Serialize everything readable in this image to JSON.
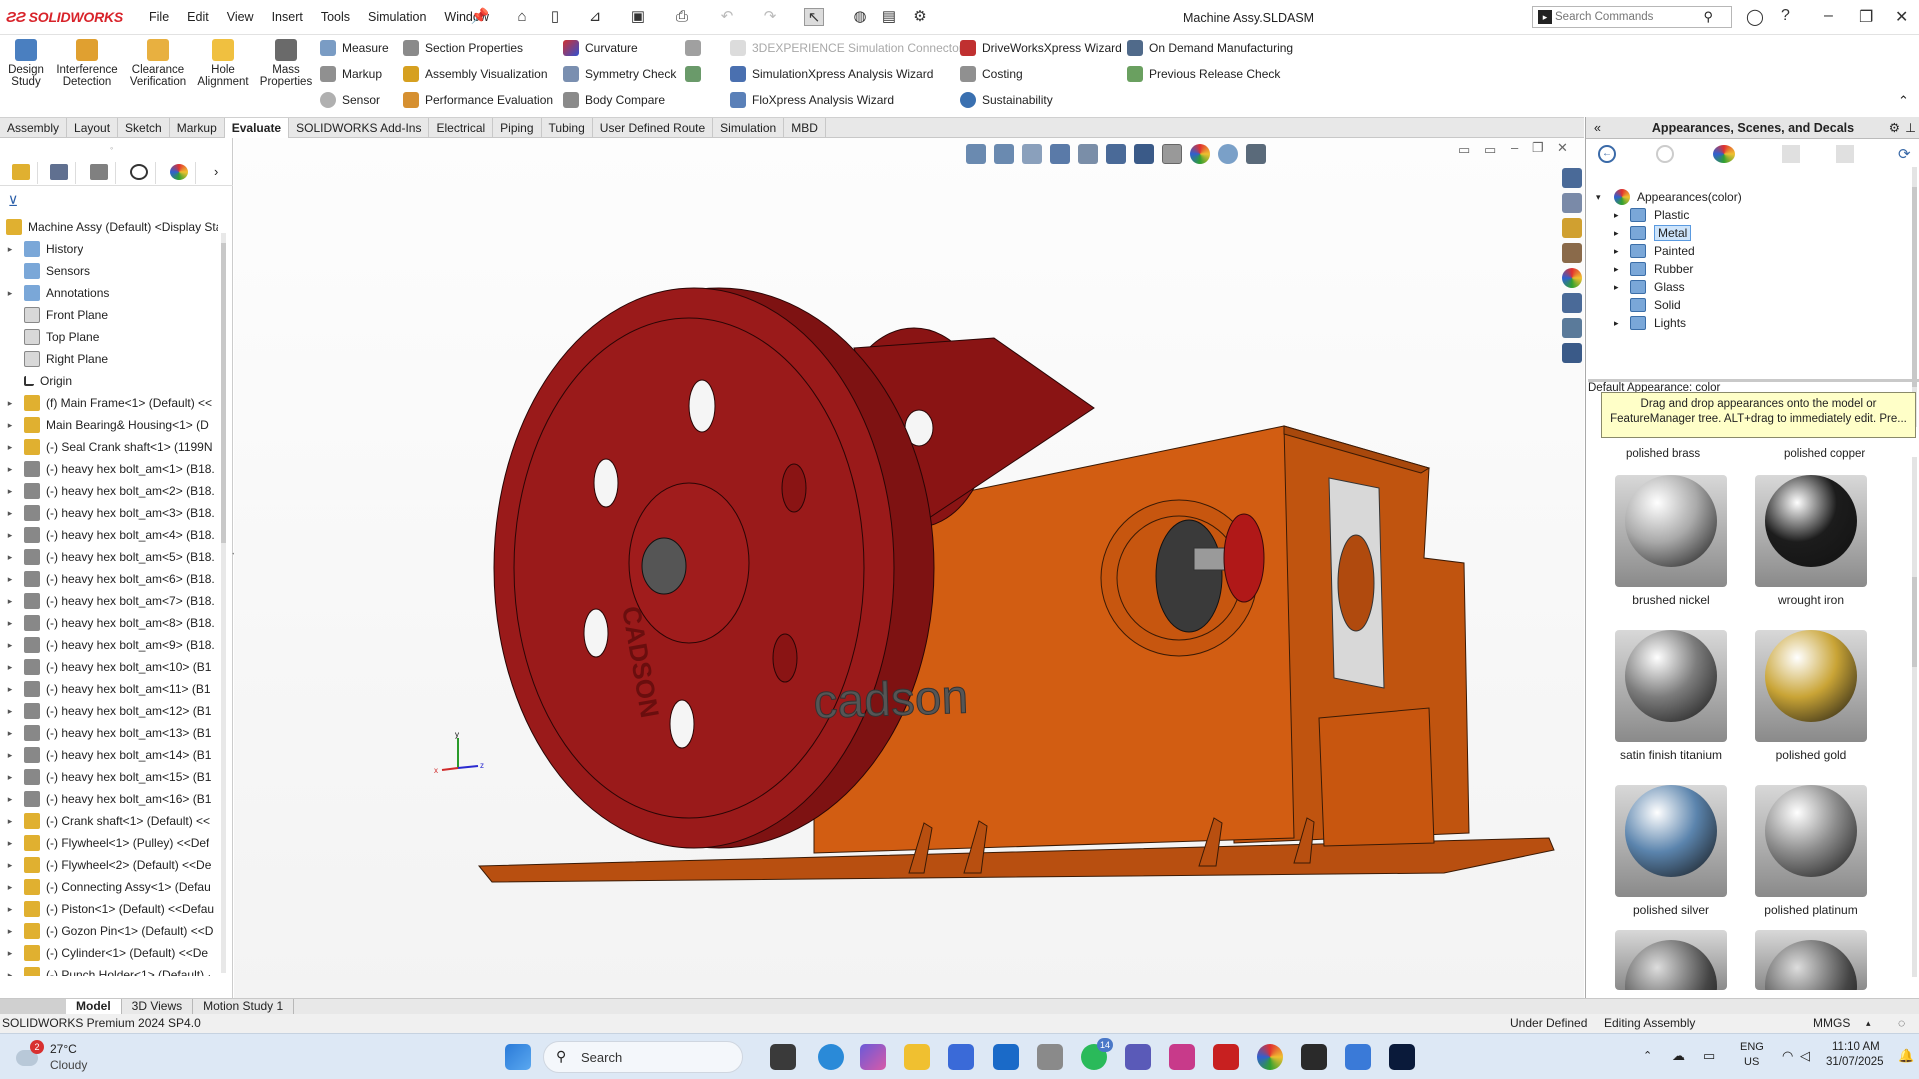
{
  "app": {
    "name": "SOLIDWORKS",
    "doc_title": "Machine Assy.SLDASM",
    "menus": [
      "File",
      "Edit",
      "View",
      "Insert",
      "Tools",
      "Simulation",
      "Window"
    ],
    "search_placeholder": "Search Commands"
  },
  "ribbon": {
    "big": [
      {
        "label": "Design Study"
      },
      {
        "label": "Interference Detection"
      },
      {
        "label": "Clearance Verification"
      },
      {
        "label": "Hole Alignment"
      },
      {
        "label": "Mass Properties"
      }
    ],
    "col1": [
      "Measure",
      "Markup",
      "Sensor"
    ],
    "col2": [
      "Section Properties",
      "Assembly Visualization",
      "Performance Evaluation"
    ],
    "col3": [
      "Curvature",
      "Symmetry Check",
      "Body Compare"
    ],
    "col4": [
      "3DEXPERIENCE Simulation Connector",
      "SimulationXpress Analysis Wizard",
      "FloXpress Analysis Wizard"
    ],
    "col5": [
      "DriveWorksXpress Wizard",
      "Costing",
      "Sustainability"
    ],
    "col6": [
      "On Demand Manufacturing",
      "Previous Release Check"
    ]
  },
  "command_tabs": [
    "Assembly",
    "Layout",
    "Sketch",
    "Markup",
    "Evaluate",
    "SOLIDWORKS Add-Ins",
    "Electrical",
    "Piping",
    "Tubing",
    "User Defined Route",
    "Simulation",
    "MBD"
  ],
  "active_command_tab": "Evaluate",
  "tree": [
    {
      "label": "Machine Assy (Default) <Display Sta",
      "icon": "assembly",
      "exp": false,
      "root": true
    },
    {
      "label": "History",
      "icon": "folder",
      "exp": true
    },
    {
      "label": "Sensors",
      "icon": "folder",
      "exp": false
    },
    {
      "label": "Annotations",
      "icon": "annot",
      "exp": true
    },
    {
      "label": "Front Plane",
      "icon": "plane",
      "exp": false
    },
    {
      "label": "Top Plane",
      "icon": "plane",
      "exp": false
    },
    {
      "label": "Right Plane",
      "icon": "plane",
      "exp": false
    },
    {
      "label": "Origin",
      "icon": "origin",
      "exp": false
    },
    {
      "label": "(f) Main Frame<1> (Default) <<",
      "icon": "asm",
      "exp": true
    },
    {
      "label": "Main Bearing& Housing<1> (D",
      "icon": "asm",
      "exp": true
    },
    {
      "label": "(-) Seal Crank shaft<1> (1199N",
      "icon": "asm",
      "exp": true
    },
    {
      "label": "(-) heavy hex bolt_am<1> (B18.",
      "icon": "bolt",
      "exp": true
    },
    {
      "label": "(-) heavy hex bolt_am<2> (B18.",
      "icon": "bolt",
      "exp": true
    },
    {
      "label": "(-) heavy hex bolt_am<3> (B18.",
      "icon": "bolt",
      "exp": true
    },
    {
      "label": "(-) heavy hex bolt_am<4> (B18.",
      "icon": "bolt",
      "exp": true
    },
    {
      "label": "(-) heavy hex bolt_am<5> (B18.",
      "icon": "bolt",
      "exp": true
    },
    {
      "label": "(-) heavy hex bolt_am<6> (B18.",
      "icon": "bolt",
      "exp": true
    },
    {
      "label": "(-) heavy hex bolt_am<7> (B18.",
      "icon": "bolt",
      "exp": true
    },
    {
      "label": "(-) heavy hex bolt_am<8> (B18.",
      "icon": "bolt",
      "exp": true
    },
    {
      "label": "(-) heavy hex bolt_am<9> (B18.",
      "icon": "bolt",
      "exp": true
    },
    {
      "label": "(-) heavy hex bolt_am<10> (B1",
      "icon": "bolt",
      "exp": true
    },
    {
      "label": "(-) heavy hex bolt_am<11> (B1",
      "icon": "bolt",
      "exp": true
    },
    {
      "label": "(-) heavy hex bolt_am<12> (B1",
      "icon": "bolt",
      "exp": true
    },
    {
      "label": "(-) heavy hex bolt_am<13> (B1",
      "icon": "bolt",
      "exp": true
    },
    {
      "label": "(-) heavy hex bolt_am<14> (B1",
      "icon": "bolt",
      "exp": true
    },
    {
      "label": "(-) heavy hex bolt_am<15> (B1",
      "icon": "bolt",
      "exp": true
    },
    {
      "label": "(-) heavy hex bolt_am<16> (B1",
      "icon": "bolt",
      "exp": true
    },
    {
      "label": "(-) Crank shaft<1> (Default) <<",
      "icon": "asm",
      "exp": true
    },
    {
      "label": "(-) Flywheel<1> (Pulley) <<Def",
      "icon": "asm",
      "exp": true
    },
    {
      "label": "(-) Flywheel<2> (Default) <<De",
      "icon": "asm",
      "exp": true
    },
    {
      "label": "(-) Connecting Assy<1> (Defau",
      "icon": "asm",
      "exp": true
    },
    {
      "label": "(-) Piston<1> (Default) <<Defau",
      "icon": "asm",
      "exp": true
    },
    {
      "label": "(-) Gozon Pin<1> (Default) <<D",
      "icon": "asm",
      "exp": true
    },
    {
      "label": "(-) Cylinder<1> (Default) <<De",
      "icon": "asm",
      "exp": true
    },
    {
      "label": "(-) Punch Holder<1> (Default) ·",
      "icon": "asm",
      "exp": true
    }
  ],
  "model": {
    "brand_text": "cadson",
    "flywheel_text": "CADSON"
  },
  "triad": {
    "x": "x",
    "y": "y",
    "z": "z"
  },
  "right_panel": {
    "title": "Appearances, Scenes, and Decals",
    "root": "Appearances(color)",
    "categories": [
      "Plastic",
      "Metal",
      "Painted",
      "Rubber",
      "Glass",
      "Solid",
      "Lights"
    ],
    "selected": "Metal",
    "default_appearance": "Default Appearance: color",
    "tip": "Drag and drop appearances onto the model or FeatureManager tree.  ALT+drag to immediately edit.  Pre...",
    "swatches_partial": [
      "polished brass",
      "polished copper"
    ],
    "swatches": [
      {
        "name": "brushed nickel",
        "color": "#a9a9a9"
      },
      {
        "name": "wrought iron",
        "color": "#1c1c1c"
      },
      {
        "name": "satin finish titanium",
        "color": "#7c7c7c"
      },
      {
        "name": "polished gold",
        "color": "#c9a436"
      },
      {
        "name": "polished silver",
        "color": "#5b84ad"
      },
      {
        "name": "polished platinum",
        "color": "#8d8d8d"
      }
    ]
  },
  "bottom_tabs": [
    "Model",
    "3D Views",
    "Motion Study 1"
  ],
  "status": {
    "version": "SOLIDWORKS Premium 2024 SP4.0",
    "state": "Under Defined",
    "mode": "Editing Assembly",
    "units": "MMGS"
  },
  "taskbar": {
    "weather_temp": "27°C",
    "weather_text": "Cloudy",
    "search": "Search",
    "lang1": "ENG",
    "lang2": "US",
    "time": "11:10 AM",
    "date": "31/07/2025",
    "badge1": "2",
    "badge2": "14"
  }
}
